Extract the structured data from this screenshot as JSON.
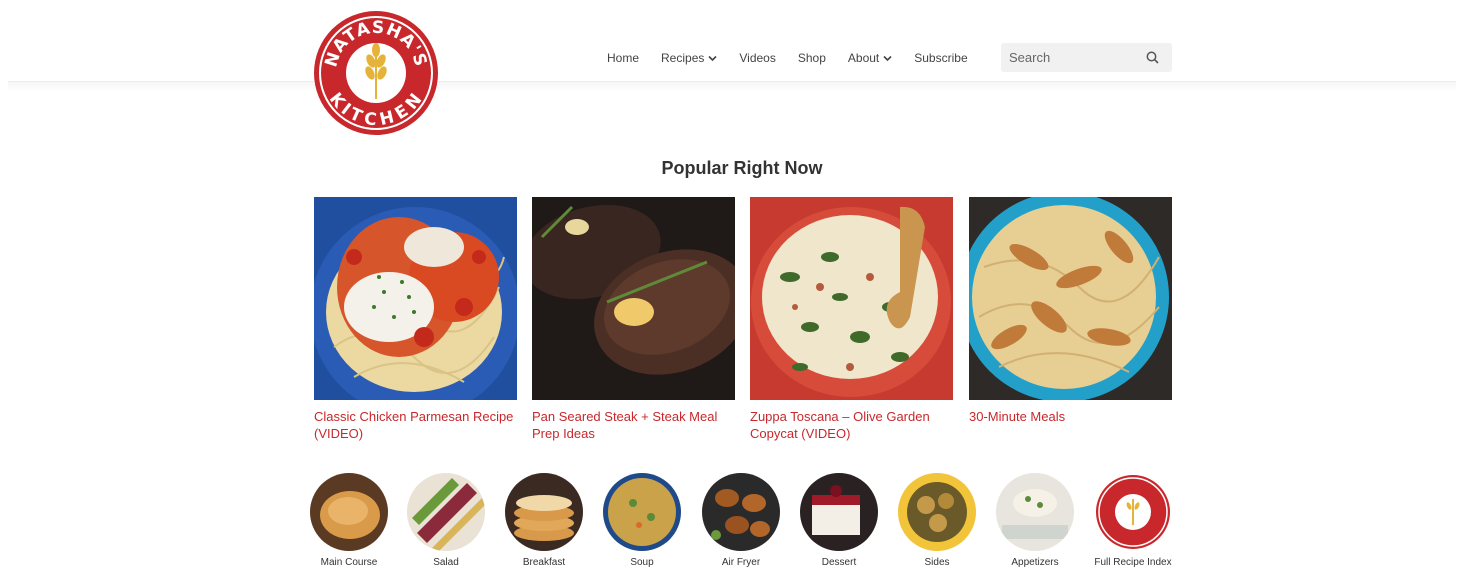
{
  "brand": {
    "logo_text_top": "NATASHA'S",
    "logo_text_bottom": "KITCHEN"
  },
  "nav": {
    "items": [
      {
        "label": "Home",
        "dropdown": false
      },
      {
        "label": "Recipes",
        "dropdown": true
      },
      {
        "label": "Videos",
        "dropdown": false
      },
      {
        "label": "Shop",
        "dropdown": false
      },
      {
        "label": "About",
        "dropdown": true
      },
      {
        "label": "Subscribe",
        "dropdown": false
      }
    ],
    "search_placeholder": "Search"
  },
  "popular": {
    "title": "Popular Right Now",
    "cards": [
      {
        "title": "Classic Chicken Parmesan Recipe (VIDEO)"
      },
      {
        "title": "Pan Seared Steak + Steak Meal Prep Ideas"
      },
      {
        "title": "Zuppa Toscana – Olive Garden Copycat (VIDEO)"
      },
      {
        "title": "30-Minute Meals"
      }
    ]
  },
  "categories": [
    {
      "label": "Main Course"
    },
    {
      "label": "Salad"
    },
    {
      "label": "Breakfast"
    },
    {
      "label": "Soup"
    },
    {
      "label": "Air Fryer"
    },
    {
      "label": "Dessert"
    },
    {
      "label": "Sides"
    },
    {
      "label": "Appetizers"
    },
    {
      "label": "Full Recipe Index"
    }
  ],
  "colors": {
    "brand_red": "#c8282c",
    "link_red": "#c8282c"
  }
}
